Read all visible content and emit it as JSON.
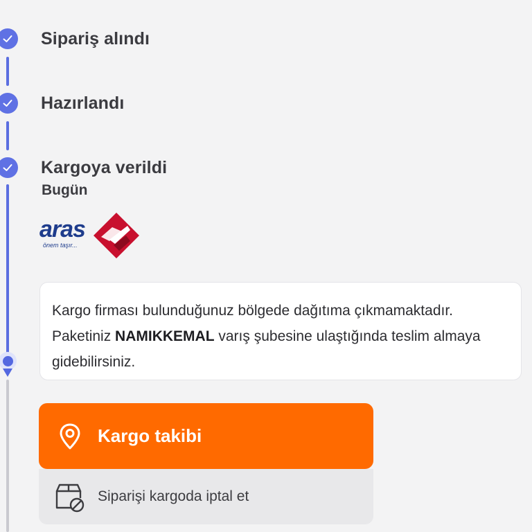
{
  "timeline": {
    "steps": [
      {
        "title": "Sipariş alındı",
        "icon": "check-icon"
      },
      {
        "title": "Hazırlandı",
        "icon": "check-icon"
      },
      {
        "title": "Kargoya verildi",
        "date": "Bugün",
        "icon": "check-icon"
      }
    ],
    "current_icon": "current-step-marker-icon"
  },
  "carrier": {
    "logo_text": "aras",
    "slogan": "önem taşır..."
  },
  "info": {
    "text_before": "Kargo firması bulunduğunuz bölgede dağıtıma çıkmamaktadır. Paketiniz ",
    "branch": "NAMIKKEMAL",
    "text_after": " varış şubesine ulaştığında teslim almaya gidebilirsiniz."
  },
  "actions": {
    "track_label": "Kargo takibi",
    "track_icon": "location-pin-icon",
    "cancel_label": "Siparişi kargoda iptal et",
    "cancel_icon": "box-cancel-icon"
  },
  "colors": {
    "accent": "#ff6a00",
    "timeline": "#5b6ee0",
    "background": "#f3f3f4"
  }
}
